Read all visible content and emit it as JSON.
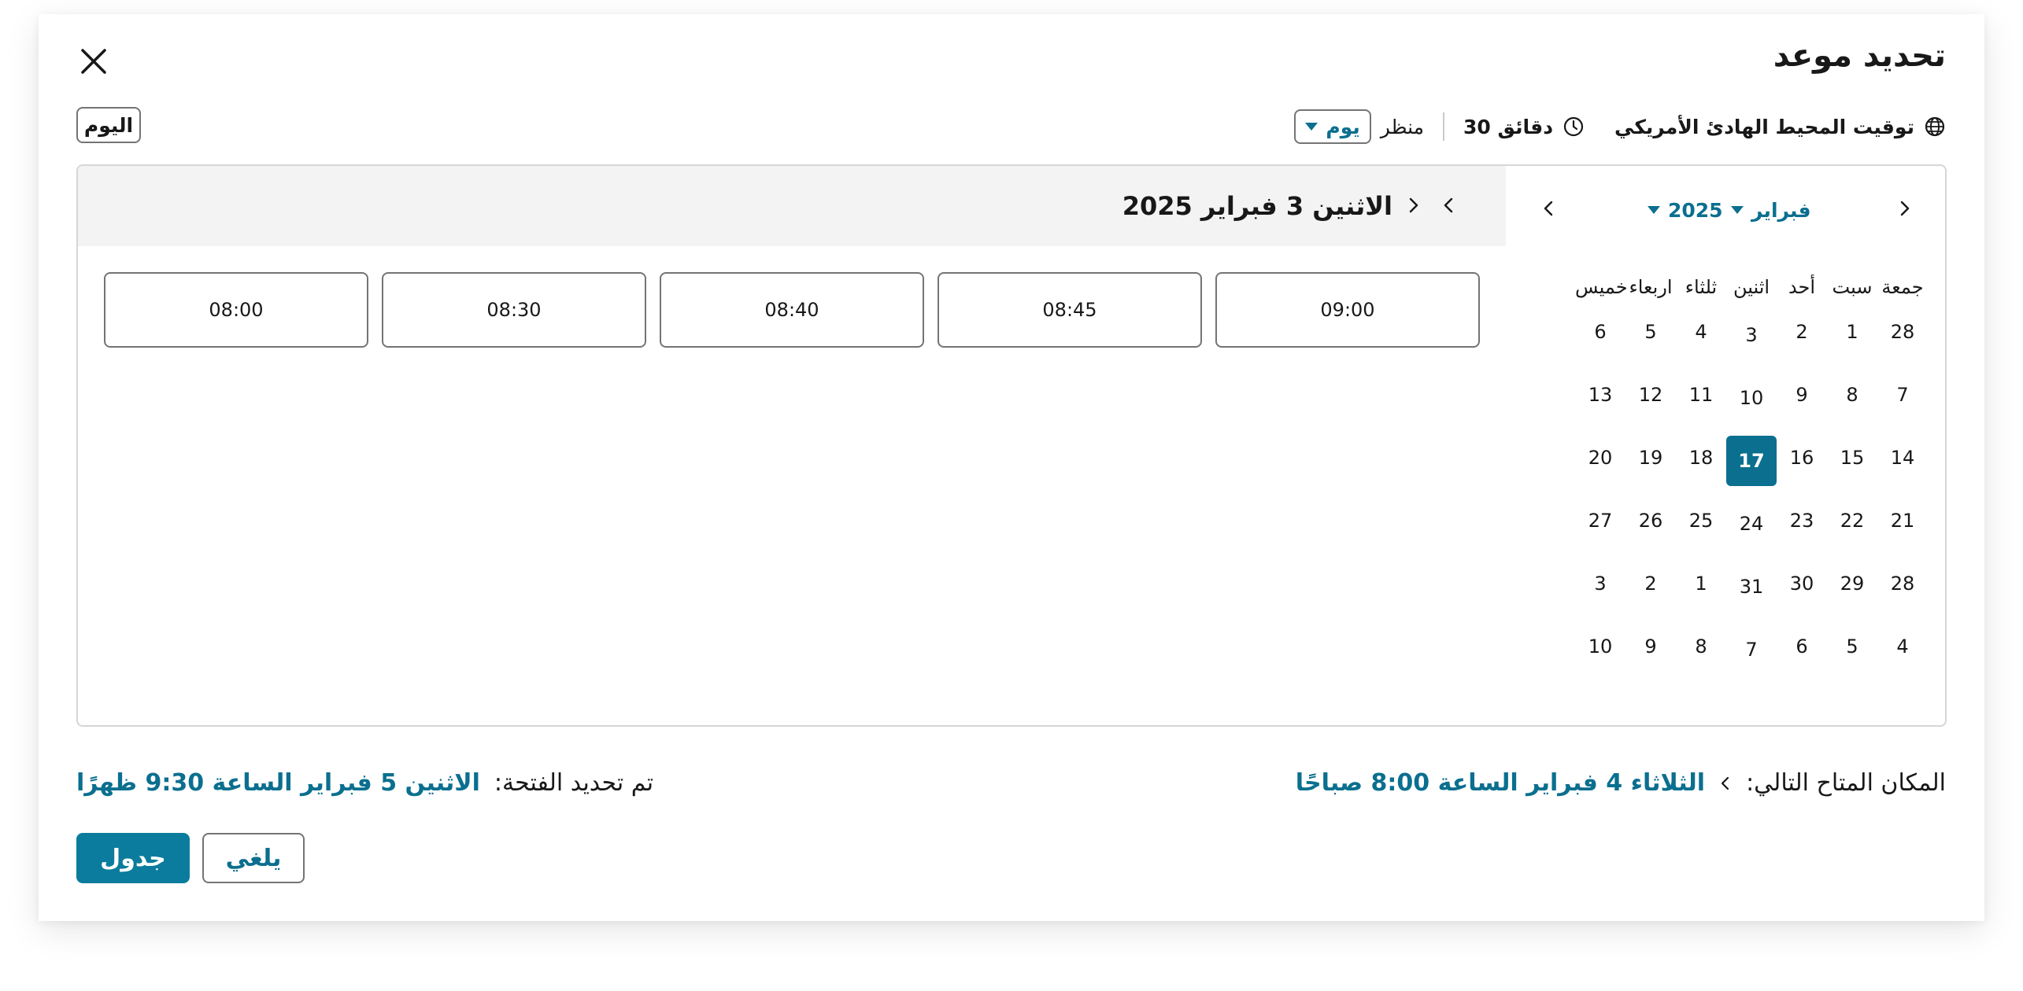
{
  "dialog": {
    "title": "تحديد موعد",
    "close_icon": "close-icon"
  },
  "info": {
    "timezone_icon": "globe-icon",
    "timezone": "توقيت المحيط الهادئ الأمريكي",
    "duration_icon": "clock-icon",
    "duration": "30 دقائق",
    "view_label": "منظر",
    "view_value": "يوم",
    "today_button": "اليوم"
  },
  "calendar": {
    "month": "فبراير",
    "year": "2025",
    "weekdays": [
      "جمعة",
      "سبت",
      "أحد",
      "اثنين",
      "ثلثاء",
      "اربعاء",
      "خميس"
    ],
    "weeks": [
      [
        "28",
        "1",
        "2",
        "3",
        "4",
        "5",
        "6"
      ],
      [
        "7",
        "8",
        "9",
        "10",
        "11",
        "12",
        "13"
      ],
      [
        "14",
        "15",
        "16",
        "17",
        "18",
        "19",
        "20"
      ],
      [
        "21",
        "22",
        "23",
        "24",
        "25",
        "26",
        "27"
      ],
      [
        "28",
        "29",
        "30",
        "31",
        "1",
        "2",
        "3"
      ],
      [
        "4",
        "5",
        "6",
        "7",
        "8",
        "9",
        "10"
      ]
    ],
    "selected_day": "17",
    "accent": "#0b6f8f"
  },
  "day_view": {
    "title": "الاثنين 3 فبراير 2025",
    "slots": [
      "09:00",
      "08:45",
      "08:40",
      "08:30",
      "08:00"
    ]
  },
  "footer": {
    "next_label": ":المكان المتاح التالي",
    "next_value": "الثلاثاء 4 فبراير الساعة 8:00 صباحًا",
    "selected_label": ":تم تحديد الفتحة",
    "selected_value": "الاثنين 5 فبراير الساعة 9:30 ظهرًا",
    "cancel_button": "يلغي",
    "schedule_button": "جدول"
  }
}
